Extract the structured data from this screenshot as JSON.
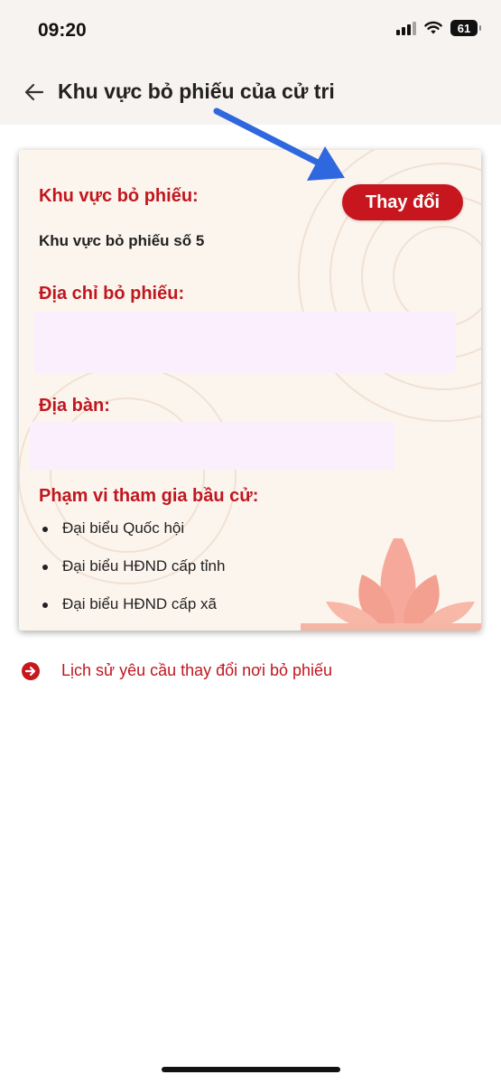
{
  "status_bar": {
    "time": "09:20",
    "battery": "61",
    "icons": [
      "signal-icon",
      "wifi-icon",
      "battery-icon"
    ]
  },
  "header": {
    "back_icon": "back-arrow-icon",
    "title": "Khu vực bỏ phiếu của cử tri"
  },
  "card": {
    "area_label": "Khu vực bỏ phiếu:",
    "area_value": "Khu vực bỏ phiếu số 5",
    "change_button": "Thay đổi",
    "address_label": "Địa chỉ bỏ phiếu:",
    "locality_label": "Địa bàn:",
    "scope_label": "Phạm vi tham gia bầu cử:",
    "scope_items": [
      "Đại biểu Quốc hội",
      "Đại biểu HĐND cấp tỉnh",
      "Đại biểu HĐND cấp xã"
    ]
  },
  "history_link": {
    "icon": "arrow-right-circle-icon",
    "text": "Lịch sử yêu cầu thay đổi nơi bỏ phiếu"
  },
  "colors": {
    "accent": "#c8161f",
    "card_bg": "#fcf5ee",
    "annotation_arrow": "#2f67de"
  }
}
